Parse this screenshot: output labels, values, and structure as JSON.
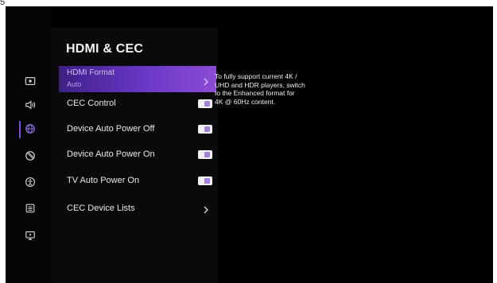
{
  "corner_label": "5",
  "page": {
    "title": "HDMI & CEC"
  },
  "rail": {
    "icons": [
      "picture-icon",
      "sound-icon",
      "globe-icon",
      "block-icon",
      "accessibility-icon",
      "list-icon",
      "support-icon"
    ],
    "selected_index": 2,
    "accent": "#7b55d6"
  },
  "settings": {
    "hdmi_format": {
      "label": "HDMI Format",
      "value": "Auto"
    },
    "cec_control": {
      "label": "CEC Control",
      "enabled": true
    },
    "device_auto_power_off": {
      "label": "Device Auto Power Off",
      "enabled": true
    },
    "device_auto_power_on": {
      "label": "Device Auto Power On",
      "enabled": true
    },
    "tv_auto_power_on": {
      "label": "TV Auto Power On",
      "enabled": true
    },
    "cec_device_lists": {
      "label": "CEC Device Lists"
    }
  },
  "description": {
    "line1": "To fully support current 4K /",
    "line2": "UHD and HDR players, switch",
    "line3": "to the Enhanced format for",
    "line4": "4K @ 60Hz content."
  },
  "colors": {
    "highlight_start": "#3e1f86",
    "highlight_end": "#8d4bd4",
    "toggle_knob": "#a77fe2"
  }
}
